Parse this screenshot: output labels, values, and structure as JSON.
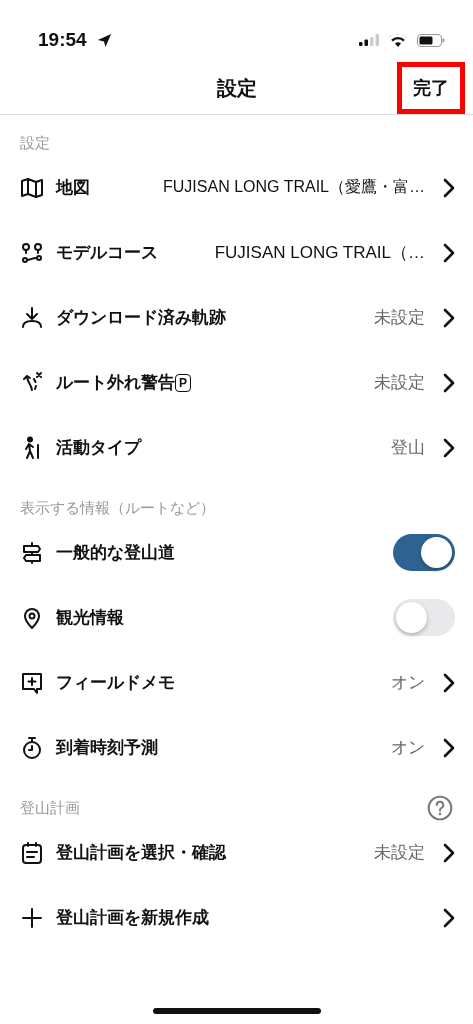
{
  "status_bar": {
    "time": "19:54"
  },
  "nav": {
    "title": "設定",
    "done": "完了",
    "done_highlighted": true
  },
  "sections": [
    {
      "header": "設定",
      "help": false,
      "rows": [
        {
          "kind": "link",
          "label": "地図",
          "value": "FUJISAN LONG TRAIL（愛鷹・富…",
          "value_muted": false
        },
        {
          "kind": "link",
          "label": "モデルコース",
          "value": "FUJISAN LONG TRAIL（…",
          "value_muted": false
        },
        {
          "kind": "link",
          "label": "ダウンロード済み軌跡",
          "value": "未設定",
          "value_muted": true
        },
        {
          "kind": "link",
          "label": "ルート外れ警告",
          "badge": "P",
          "value": "未設定",
          "value_muted": true
        },
        {
          "kind": "link",
          "label": "活動タイプ",
          "value": "登山",
          "value_muted": true
        }
      ]
    },
    {
      "header": "表示する情報（ルートなど）",
      "help": false,
      "rows": [
        {
          "kind": "toggle",
          "label": "一般的な登山道",
          "on": true
        },
        {
          "kind": "toggle",
          "label": "観光情報",
          "on": false
        },
        {
          "kind": "link",
          "label": "フィールドメモ",
          "value": "オン",
          "value_muted": true
        },
        {
          "kind": "link",
          "label": "到着時刻予測",
          "value": "オン",
          "value_muted": true
        }
      ]
    },
    {
      "header": "登山計画",
      "help": true,
      "rows": [
        {
          "kind": "link",
          "label": "登山計画を選択・確認",
          "value": "未設定",
          "value_muted": true
        },
        {
          "kind": "action",
          "label": "登山計画を新規作成"
        }
      ]
    }
  ]
}
